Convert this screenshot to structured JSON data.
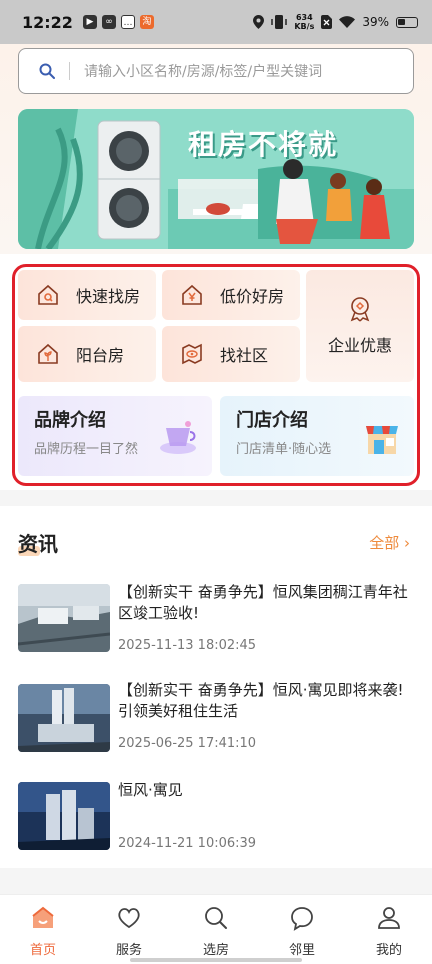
{
  "status_bar": {
    "time": "12:22",
    "speed_value": "634",
    "speed_unit": "KB/s",
    "battery": "39%"
  },
  "search": {
    "placeholder": "请输入小区名称/房源/标签/户型关键词"
  },
  "banner": {
    "title": "租房不将就"
  },
  "quick_menu": {
    "items": [
      {
        "label": "快速找房",
        "icon": "house-search-icon"
      },
      {
        "label": "低价好房",
        "icon": "yen-house-icon"
      },
      {
        "label": "企业优惠",
        "icon": "ribbon-badge-icon"
      },
      {
        "label": "阳台房",
        "icon": "plant-house-icon"
      },
      {
        "label": "找社区",
        "icon": "eye-map-icon"
      }
    ],
    "brand": {
      "title": "品牌介绍",
      "subtitle": "品牌历程一目了然"
    },
    "store": {
      "title": "门店介绍",
      "subtitle": "门店清单·随心选"
    }
  },
  "news": {
    "title": "资讯",
    "all_label": "全部 ›",
    "items": [
      {
        "title": "【创新实干 奋勇争先】恒风集团稠江青年社区竣工验收!",
        "date": "2025-11-13 18:02:45"
      },
      {
        "title": "【创新实干 奋勇争先】恒风·寓见即将来袭!引领美好租住生活",
        "date": "2025-06-25 17:41:10"
      },
      {
        "title": "恒风·寓见",
        "date": "2024-11-21 10:06:39"
      }
    ]
  },
  "tabbar": {
    "items": [
      {
        "label": "首页",
        "icon": "home-icon",
        "active": true
      },
      {
        "label": "服务",
        "icon": "heart-icon",
        "active": false
      },
      {
        "label": "选房",
        "icon": "search-icon",
        "active": false
      },
      {
        "label": "邻里",
        "icon": "chat-icon",
        "active": false
      },
      {
        "label": "我的",
        "icon": "user-icon",
        "active": false
      }
    ]
  },
  "colors": {
    "accent": "#ee6a3c",
    "highlight_border": "#e0202a",
    "link": "#ee8a3c"
  }
}
